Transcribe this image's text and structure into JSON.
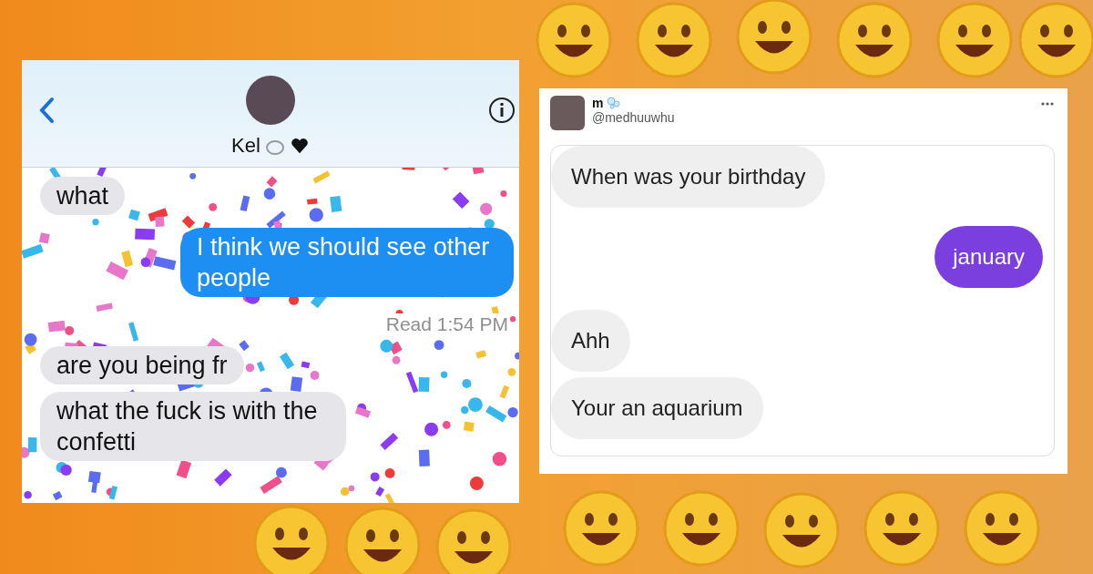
{
  "left_chat": {
    "contact_name": "Kel",
    "messages": [
      {
        "kind": "incoming",
        "text": "what"
      },
      {
        "kind": "outgoing",
        "text": "I think we should see other people"
      },
      {
        "kind": "receipt",
        "text": "Read 1:54 PM"
      },
      {
        "kind": "incoming",
        "text": "are you being fr"
      },
      {
        "kind": "incoming",
        "text": "what the fuck is with the confetti"
      }
    ]
  },
  "right_post": {
    "display_name": "m",
    "handle": "@medhuuwhu",
    "messages": [
      {
        "kind": "incoming",
        "text": "When was your birthday"
      },
      {
        "kind": "outgoing",
        "text": "january"
      },
      {
        "kind": "incoming",
        "text": "Ahh"
      },
      {
        "kind": "incoming",
        "text": "Your an aquarium"
      }
    ]
  }
}
